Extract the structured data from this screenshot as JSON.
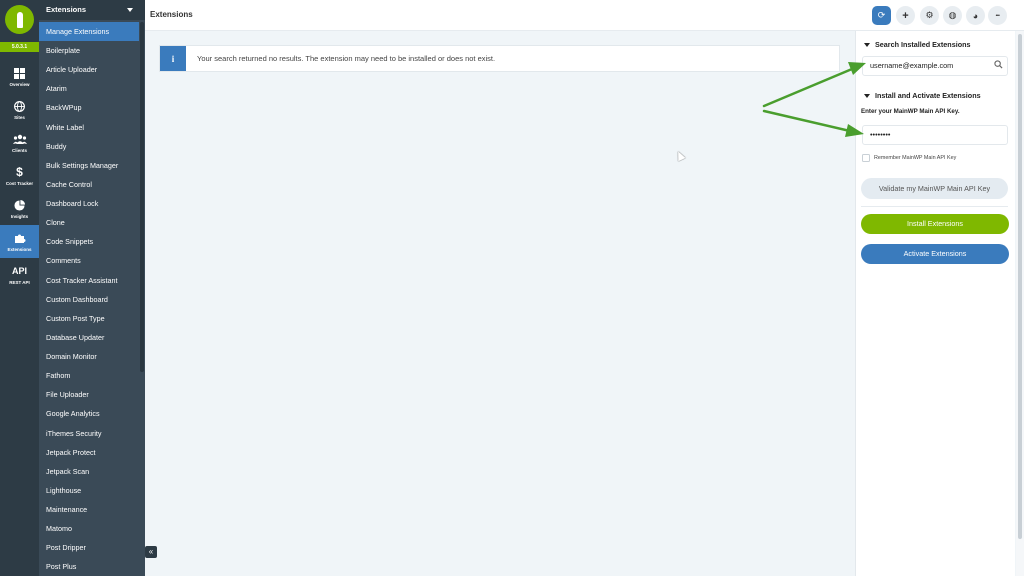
{
  "app": {
    "version": "5.0.3.1",
    "page_title": "Extensions"
  },
  "rail": [
    {
      "label": "Overview",
      "icon": "grid-icon"
    },
    {
      "label": "Sites",
      "icon": "globe-icon"
    },
    {
      "label": "Clients",
      "icon": "users-icon"
    },
    {
      "label": "Cost Tracker",
      "icon": "dollar-icon"
    },
    {
      "label": "Insights",
      "icon": "pie-chart-icon"
    },
    {
      "label": "Extensions",
      "icon": "puzzle-icon",
      "active": true
    },
    {
      "label": "REST API",
      "icon_text": "API"
    }
  ],
  "submenu": {
    "header": "Extensions",
    "items": [
      "Manage Extensions",
      "Boilerplate",
      "Article Uploader",
      "Atarim",
      "BackWPup",
      "White Label",
      "Buddy",
      "Bulk Settings Manager",
      "Cache Control",
      "Dashboard Lock",
      "Clone",
      "Code Snippets",
      "Comments",
      "Cost Tracker Assistant",
      "Custom Dashboard",
      "Custom Post Type",
      "Database Updater",
      "Domain Monitor",
      "Fathom",
      "File Uploader",
      "Google Analytics",
      "iThemes Security",
      "Jetpack Protect",
      "Jetpack Scan",
      "Lighthouse",
      "Maintenance",
      "Matomo",
      "Post Dripper",
      "Post Plus"
    ]
  },
  "toolbar": {
    "buttons": [
      {
        "icon": "sync-icon",
        "glyph": "⟳"
      },
      {
        "icon": "plus-icon",
        "glyph": "+"
      },
      {
        "icon": "gear-icon",
        "glyph": "⚙"
      },
      {
        "icon": "globe-icon",
        "glyph": "◍"
      },
      {
        "icon": "palette-icon",
        "glyph": "◕"
      },
      {
        "icon": "more-icon",
        "glyph": "•••"
      }
    ]
  },
  "main": {
    "alert_icon": "i",
    "alert_text": "Your search returned no results. The extension may need to be installed or does not exist."
  },
  "panel": {
    "search_title": "Search Installed Extensions",
    "search_value": "username@example.com",
    "install_title": "Install and Activate Extensions",
    "key_label": "Enter your MainWP Main API Key.",
    "key_value": "••••••••",
    "remember_label": "Remember MainWP Main API Key",
    "validate_label": "Validate my MainWP Main API Key",
    "install_label": "Install Extensions",
    "activate_label": "Activate Extensions"
  },
  "colors": {
    "brand_green": "#7fb800",
    "brand_blue": "#3a7bbd",
    "sidebar_dark": "#2d3b45",
    "annotation_arrow": "#4a9e2e"
  }
}
